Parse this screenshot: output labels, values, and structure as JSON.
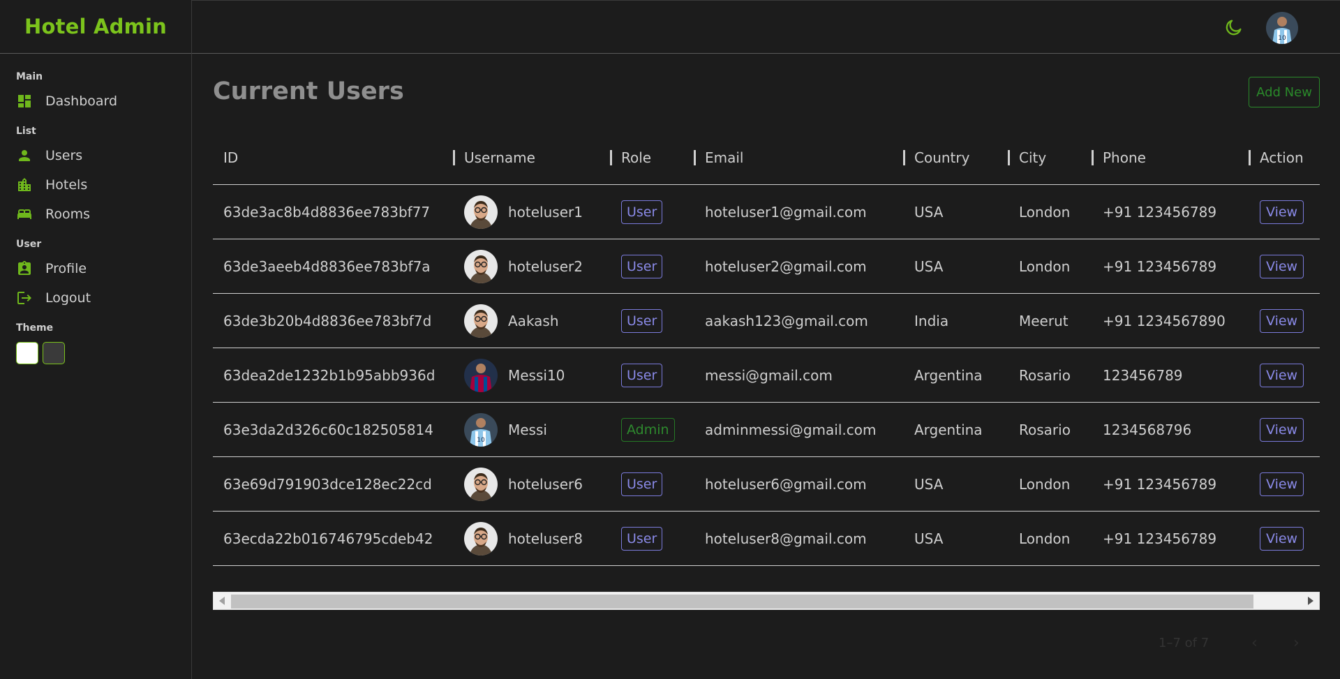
{
  "brand": "Hotel Admin",
  "sidebar": {
    "sections": [
      {
        "title": "Main",
        "items": [
          {
            "label": "Dashboard",
            "icon": "dashboard-icon"
          }
        ]
      },
      {
        "title": "List",
        "items": [
          {
            "label": "Users",
            "icon": "person-icon"
          },
          {
            "label": "Hotels",
            "icon": "building-icon"
          },
          {
            "label": "Rooms",
            "icon": "bed-icon"
          }
        ]
      },
      {
        "title": "User",
        "items": [
          {
            "label": "Profile",
            "icon": "id-badge-icon"
          },
          {
            "label": "Logout",
            "icon": "logout-icon"
          }
        ]
      }
    ],
    "theme_title": "Theme"
  },
  "header": {
    "theme_toggle_icon": "moon-icon",
    "avatar_icon": "user-avatar-messi"
  },
  "main": {
    "title": "Current Users",
    "add_new_label": "Add New",
    "columns": [
      "ID",
      "Username",
      "Role",
      "Email",
      "Country",
      "City",
      "Phone",
      "Action"
    ],
    "rows": [
      {
        "id": "63de3ac8b4d8836ee783bf77",
        "username": "hoteluser1",
        "avatar": "man-glasses",
        "role": "User",
        "email": "hoteluser1@gmail.com",
        "country": "USA",
        "city": "London",
        "phone": "+91 123456789",
        "action": "View"
      },
      {
        "id": "63de3aeeb4d8836ee783bf7a",
        "username": "hoteluser2",
        "avatar": "man-glasses",
        "role": "User",
        "email": "hoteluser2@gmail.com",
        "country": "USA",
        "city": "London",
        "phone": "+91 123456789",
        "action": "View"
      },
      {
        "id": "63de3b20b4d8836ee783bf7d",
        "username": "Aakash",
        "avatar": "man-glasses",
        "role": "User",
        "email": "aakash123@gmail.com",
        "country": "India",
        "city": "Meerut",
        "phone": "+91 1234567890",
        "action": "View"
      },
      {
        "id": "63dea2de1232b1b95abb936d",
        "username": "Messi10",
        "avatar": "barca-player",
        "role": "User",
        "email": "messi@gmail.com",
        "country": "Argentina",
        "city": "Rosario",
        "phone": "123456789",
        "action": "View"
      },
      {
        "id": "63e3da2d326c60c182505814",
        "username": "Messi",
        "avatar": "argentina-player",
        "role": "Admin",
        "email": "adminmessi@gmail.com",
        "country": "Argentina",
        "city": "Rosario",
        "phone": "1234568796",
        "action": "View"
      },
      {
        "id": "63e69d791903dce128ec22cd",
        "username": "hoteluser6",
        "avatar": "man-glasses",
        "role": "User",
        "email": "hoteluser6@gmail.com",
        "country": "USA",
        "city": "London",
        "phone": "+91 123456789",
        "action": "View"
      },
      {
        "id": "63ecda22b016746795cdeb42",
        "username": "hoteluser8",
        "avatar": "man-glasses",
        "role": "User",
        "email": "hoteluser8@gmail.com",
        "country": "USA",
        "city": "London",
        "phone": "+91 123456789",
        "action": "View"
      }
    ],
    "pagination": {
      "count_label": "1–7 of 7",
      "prev_icon": "chevron-left-icon",
      "next_icon": "chevron-right-icon"
    }
  },
  "colors": {
    "accent": "#7cc41c",
    "user_badge": "#7b7bdc",
    "admin_badge": "#257a25",
    "background": "#1c1c1c"
  }
}
